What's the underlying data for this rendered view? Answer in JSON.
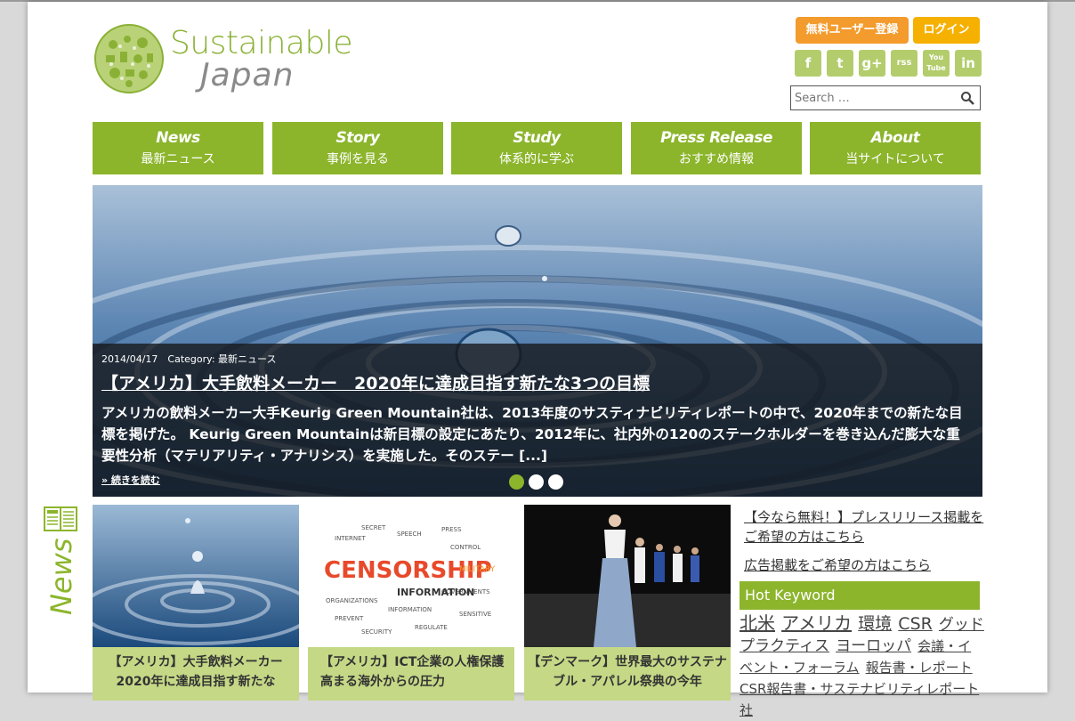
{
  "brand": {
    "line1": "Sustainable",
    "line2": "Japan"
  },
  "header": {
    "register_label": "無料ユーザー登録",
    "login_label": "ログイン"
  },
  "social": [
    "f",
    "t",
    "g+",
    "rss",
    "You Tube",
    "in"
  ],
  "search": {
    "placeholder": "Search …"
  },
  "nav": [
    {
      "en": "News",
      "jp": "最新ニュース"
    },
    {
      "en": "Story",
      "jp": "事例を見る"
    },
    {
      "en": "Study",
      "jp": "体系的に学ぶ"
    },
    {
      "en": "Press Release",
      "jp": "おすすめ情報"
    },
    {
      "en": "About",
      "jp": "当サイトについて"
    }
  ],
  "hero": {
    "meta": "2014/04/17　Category: 最新ニュース",
    "title": "【アメリカ】大手飲料メーカー　2020年に達成目指す新たな3つの目標",
    "body": "アメリカの飲料メーカー大手Keurig Green Mountain社は、2013年度のサスティナビリティレポートの中で、2020年までの新たな目標を掲げた。 Keurig Green Mountainは新目標の設定にあたり、2012年に、社内外の120のステークホルダーを巻き込んだ膨大な重要性分析（マテリアリティ・アナリシス）を実施した。そのステー [...]",
    "more": "» 続きを読む",
    "slides_total": 3,
    "active_slide": 1
  },
  "news_label": "News",
  "cards": [
    {
      "title": "【アメリカ】大手飲料メーカー 2020年に達成目指す新たな"
    },
    {
      "title": "【アメリカ】ICT企業の人権保護　高まる海外からの圧力"
    },
    {
      "title": "【デンマーク】世界最大のサステナブル・アパレル祭典の今年"
    }
  ],
  "sidebar": {
    "link1": "【今なら無料！】プレスリリース掲載をご希望の方はこちら",
    "link2": "広告掲載をご希望の方はこちら",
    "hot_keyword": "Hot Keyword",
    "keywords": [
      "北米",
      "アメリカ",
      "環境",
      "CSR",
      "グッドプラクティス",
      "ヨーロッパ",
      "会議・イベント・フォーラム",
      "報告書・レポート",
      "CSR報告書・サステナビリティレポート",
      "社"
    ]
  },
  "colors": {
    "green": "#8cb52c",
    "light_green": "#c5d886",
    "orange": "#f39b2c",
    "yellow": "#f5b000"
  }
}
